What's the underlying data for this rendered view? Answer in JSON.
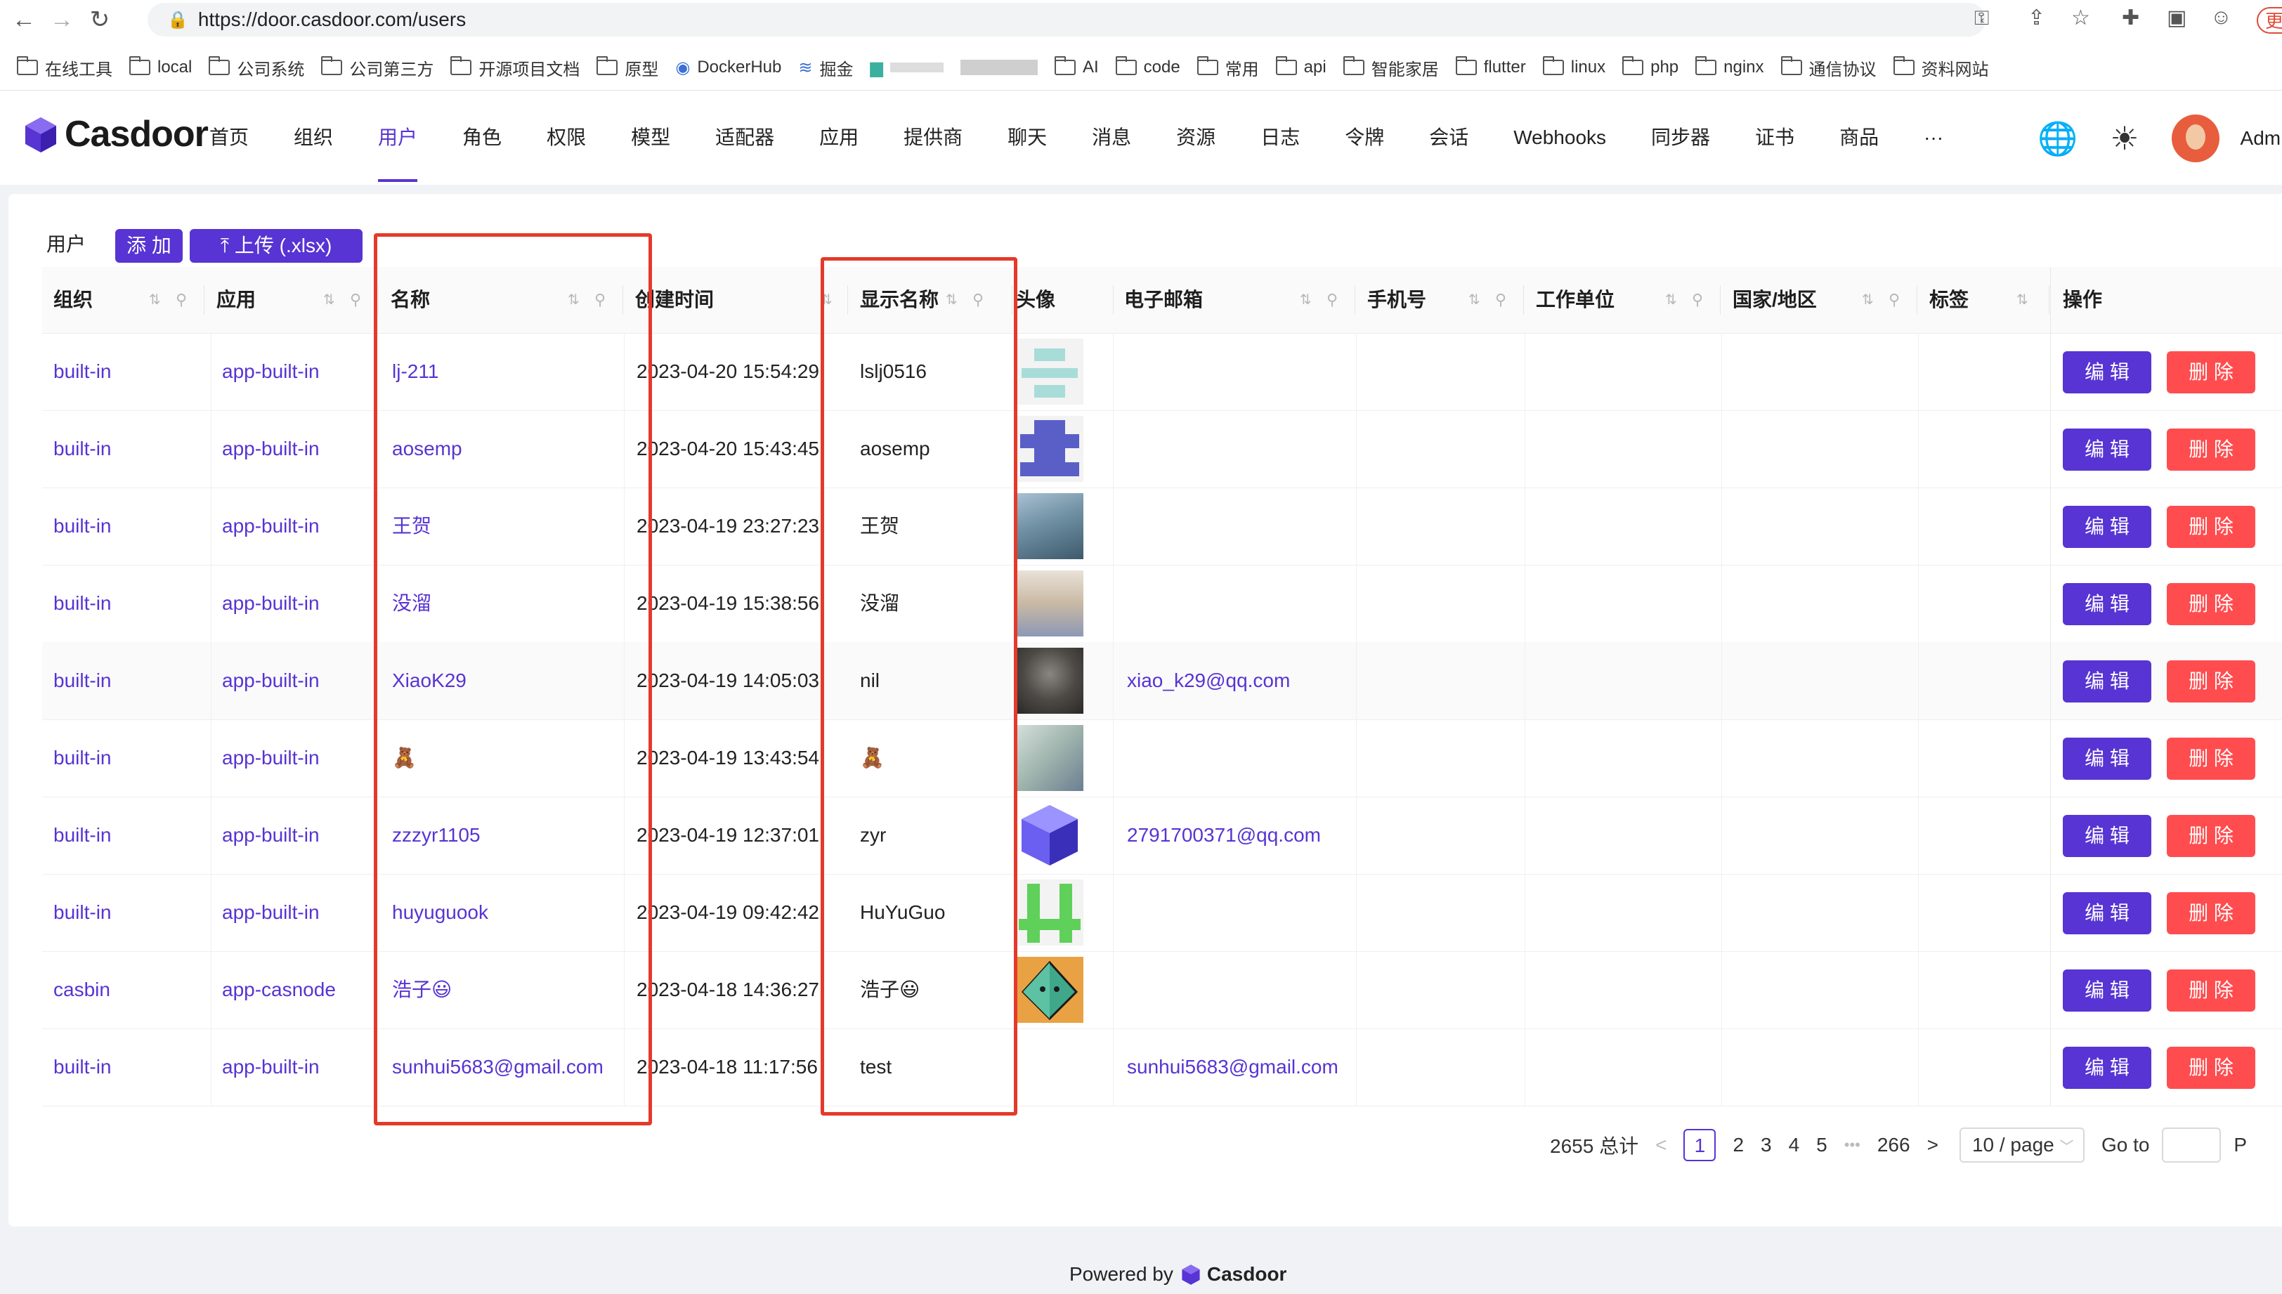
{
  "browser": {
    "url": "https://door.casdoor.com/users",
    "profile_chip": "更",
    "bookmarks": [
      "在线工具",
      "local",
      "公司系统",
      "公司第三方",
      "开源项目文档",
      "原型",
      "DockerHub",
      "掘金",
      "",
      "",
      "AI",
      "code",
      "常用",
      "api",
      "智能家居",
      "flutter",
      "linux",
      "php",
      "nginx",
      "通信协议",
      "资料网站"
    ]
  },
  "app": {
    "logo_text": "Casdoor",
    "nav": [
      "首页",
      "组织",
      "用户",
      "角色",
      "权限",
      "模型",
      "适配器",
      "应用",
      "提供商",
      "聊天",
      "消息",
      "资源",
      "日志",
      "令牌",
      "会话",
      "Webhooks",
      "同步器",
      "证书",
      "商品",
      "···"
    ],
    "active_nav": "用户",
    "user_name": "Admin"
  },
  "table": {
    "title": "用户",
    "add_label": "添 加",
    "upload_label": "上传 (.xlsx)",
    "columns": [
      "组织",
      "应用",
      "名称",
      "创建时间",
      "显示名称",
      "头像",
      "电子邮箱",
      "手机号",
      "工作单位",
      "国家/地区",
      "标签",
      "操作"
    ],
    "edit_label": "编 辑",
    "delete_label": "删 除",
    "rows": [
      {
        "org": "built-in",
        "app": "app-built-in",
        "name": "lj-211",
        "created": "2023-04-20 15:54:29",
        "display": "lslj0516",
        "email": "",
        "avatar": "teal-block",
        "avatar_color": "#a8dcd8"
      },
      {
        "org": "built-in",
        "app": "app-built-in",
        "name": "aosemp",
        "created": "2023-04-20 15:43:45",
        "display": "aosemp",
        "email": "",
        "avatar": "purple-pattern",
        "avatar_color": "#5a5fc8"
      },
      {
        "org": "built-in",
        "app": "app-built-in",
        "name": "王贺",
        "created": "2023-04-19 23:27:23",
        "display": "王贺",
        "email": "",
        "avatar": "photo",
        "avatar_color": "#6f8fa3"
      },
      {
        "org": "built-in",
        "app": "app-built-in",
        "name": "没溜",
        "created": "2023-04-19 15:38:56",
        "display": "没溜",
        "email": "",
        "avatar": "photo",
        "avatar_color": "#c9b9a4"
      },
      {
        "org": "built-in",
        "app": "app-built-in",
        "name": "XiaoK29",
        "created": "2023-04-19 14:05:03",
        "display": "nil",
        "email": "xiao_k29@qq.com",
        "avatar": "photo",
        "avatar_color": "#4d4a46"
      },
      {
        "org": "built-in",
        "app": "app-built-in",
        "name": "🧸",
        "created": "2023-04-19 13:43:54",
        "display": "🧸",
        "email": "",
        "avatar": "photo",
        "avatar_color": "#9fb3ad"
      },
      {
        "org": "built-in",
        "app": "app-built-in",
        "name": "zzzyr1105",
        "created": "2023-04-19 12:37:01",
        "display": "zyr",
        "email": "2791700371@qq.com",
        "avatar": "cube",
        "avatar_color": "#4a3fd4"
      },
      {
        "org": "built-in",
        "app": "app-built-in",
        "name": "huyuguook",
        "created": "2023-04-19 09:42:42",
        "display": "HuYuGuo",
        "email": "",
        "avatar": "green-pattern",
        "avatar_color": "#5fd05a"
      },
      {
        "org": "casbin",
        "app": "app-casnode",
        "name": "浩子😃",
        "created": "2023-04-18 14:36:27",
        "display": "浩子😃",
        "email": "",
        "avatar": "diamond",
        "avatar_color": "#e9a243"
      },
      {
        "org": "built-in",
        "app": "app-built-in",
        "name": "sunhui5683@gmail.com",
        "created": "2023-04-18 11:17:56",
        "display": "test",
        "email": "sunhui5683@gmail.com",
        "avatar": "none",
        "avatar_color": "#ffffff"
      }
    ]
  },
  "pagination": {
    "total": "2655 总计",
    "pages": [
      "1",
      "2",
      "3",
      "4",
      "5",
      "266"
    ],
    "ellipsis": "•••",
    "prev": "<",
    "next": ">",
    "active": "1",
    "page_size": "10 / page",
    "goto_label": "Go to",
    "trailing": "P"
  },
  "footer": {
    "powered_by": "Powered by",
    "brand": "Casdoor"
  },
  "colors": {
    "accent": "#5734d3",
    "danger": "#ff4d4f",
    "annotation": "#e5392a"
  }
}
